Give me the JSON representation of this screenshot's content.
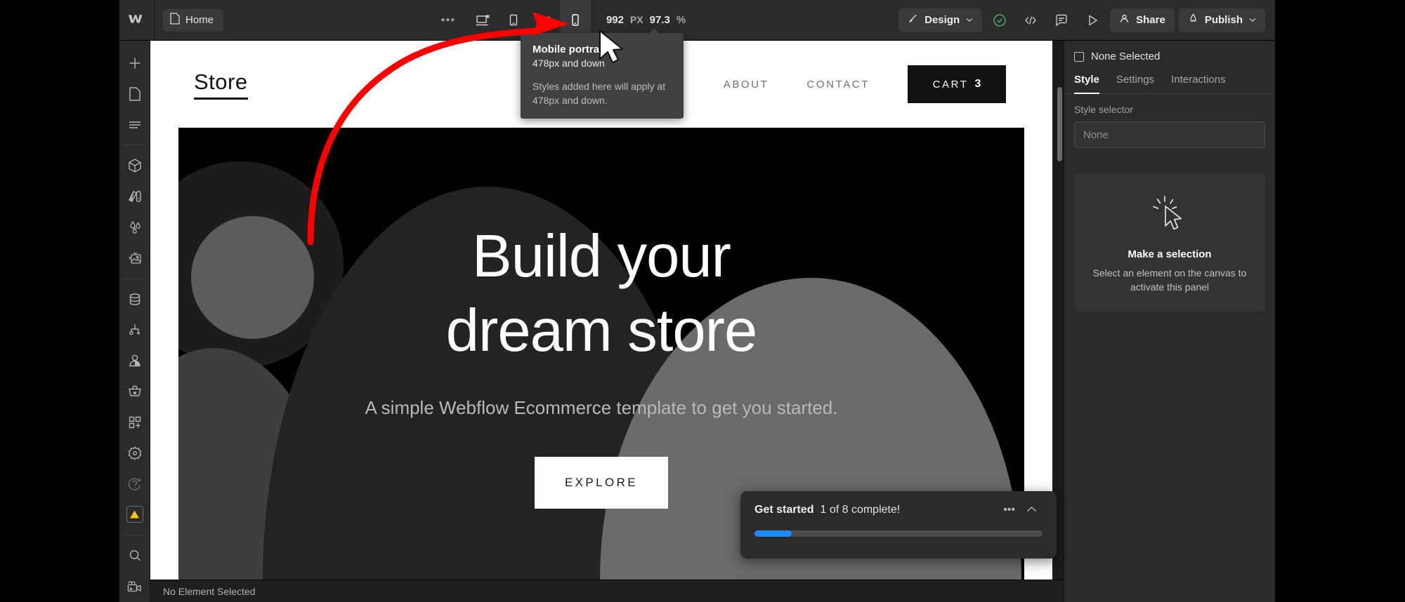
{
  "app": {
    "name": "Webflow Designer",
    "logo_icon": "webflow-logo-icon",
    "status_text": "No Element Selected"
  },
  "toolbar": {
    "page_chip": {
      "label": "Home",
      "icon": "page-icon"
    },
    "more_label": "•••",
    "breakpoints": [
      {
        "name": "desktop",
        "icon": "desktop-icon",
        "active": false
      },
      {
        "name": "tablet",
        "icon": "tablet-icon",
        "active": false
      },
      {
        "name": "mobile-landscape",
        "icon": "mobile-landscape-icon",
        "active": false
      },
      {
        "name": "mobile-portrait",
        "icon": "mobile-portrait-icon",
        "active": true
      }
    ],
    "width_value": "992",
    "width_unit": "PX",
    "zoom_value": "97.3",
    "zoom_unit": "%",
    "mode": {
      "label": "Design",
      "icon": "brush-icon",
      "caret": "⌄"
    },
    "icons": [
      {
        "name": "checkmark-circle-icon",
        "glyph": "check"
      },
      {
        "name": "code-icon",
        "glyph": "code"
      },
      {
        "name": "comment-icon",
        "glyph": "comment"
      },
      {
        "name": "preview-play-icon",
        "glyph": "play"
      }
    ],
    "share": {
      "label": "Share",
      "icon": "person-icon"
    },
    "publish": {
      "label": "Publish",
      "icon": "rocket-icon",
      "caret": "⌄"
    }
  },
  "sidebar": {
    "groups": [
      {
        "items": [
          {
            "name": "add-elements",
            "icon": "plus-icon"
          },
          {
            "name": "pages",
            "icon": "page-icon"
          },
          {
            "name": "navigator",
            "icon": "navigator-icon"
          }
        ]
      },
      {
        "items": [
          {
            "name": "components",
            "icon": "cube-icon"
          },
          {
            "name": "style-guide",
            "icon": "paint-swatch-icon"
          },
          {
            "name": "variables",
            "icon": "water-drops-icon"
          },
          {
            "name": "assets",
            "icon": "image-icon"
          }
        ]
      },
      {
        "items": [
          {
            "name": "cms",
            "icon": "database-icon"
          },
          {
            "name": "logic",
            "icon": "logic-flow-icon"
          },
          {
            "name": "users",
            "icon": "person-icon"
          },
          {
            "name": "ecommerce",
            "icon": "basket-icon"
          },
          {
            "name": "apps",
            "icon": "apps-add-icon"
          },
          {
            "name": "settings",
            "icon": "gear-flower-icon"
          },
          {
            "name": "ai-assist",
            "icon": "question-sparkle-icon"
          },
          {
            "name": "audit",
            "icon": "warning-triangle-icon",
            "highlight": "#f5c518"
          }
        ]
      },
      {
        "items": [
          {
            "name": "search",
            "icon": "search-icon"
          },
          {
            "name": "video-tutorials",
            "icon": "video-camera-icon"
          }
        ]
      }
    ]
  },
  "tooltip": {
    "title": "Mobile portrait",
    "subtitle": "478px and down",
    "body": "Styles added here will apply at 478px and down."
  },
  "canvas": {
    "site_nav": {
      "brand": "Store",
      "links": [
        "ABOUT",
        "CONTACT"
      ],
      "cart": {
        "label": "CART",
        "count": "3"
      }
    },
    "hero": {
      "heading_line1": "Build your",
      "heading_line2": "dream store",
      "subheading": "A simple Webflow Ecommerce template to get you started.",
      "cta": "EXPLORE"
    }
  },
  "get_started": {
    "title": "Get started",
    "progress_text": "1 of 8 complete!",
    "more_label": "•••",
    "collapse_icon": "chevron-up-icon",
    "progress_percent": 13,
    "progress_color": "#1a8cff"
  },
  "right_panel": {
    "selection_label": "None Selected",
    "selection_icon": "square-icon",
    "tabs": [
      {
        "label": "Style",
        "active": true
      },
      {
        "label": "Settings",
        "active": false
      },
      {
        "label": "Interactions",
        "active": false
      }
    ],
    "style_selector_label": "Style selector",
    "style_selector_value": "None",
    "empty_state": {
      "icon": "cursor-click-icon",
      "title": "Make a selection",
      "text": "Select an element on the canvas to activate this panel"
    }
  },
  "annotation": {
    "arrow_color": "#ff0000",
    "cursor_icon": "mouse-pointer-icon"
  }
}
